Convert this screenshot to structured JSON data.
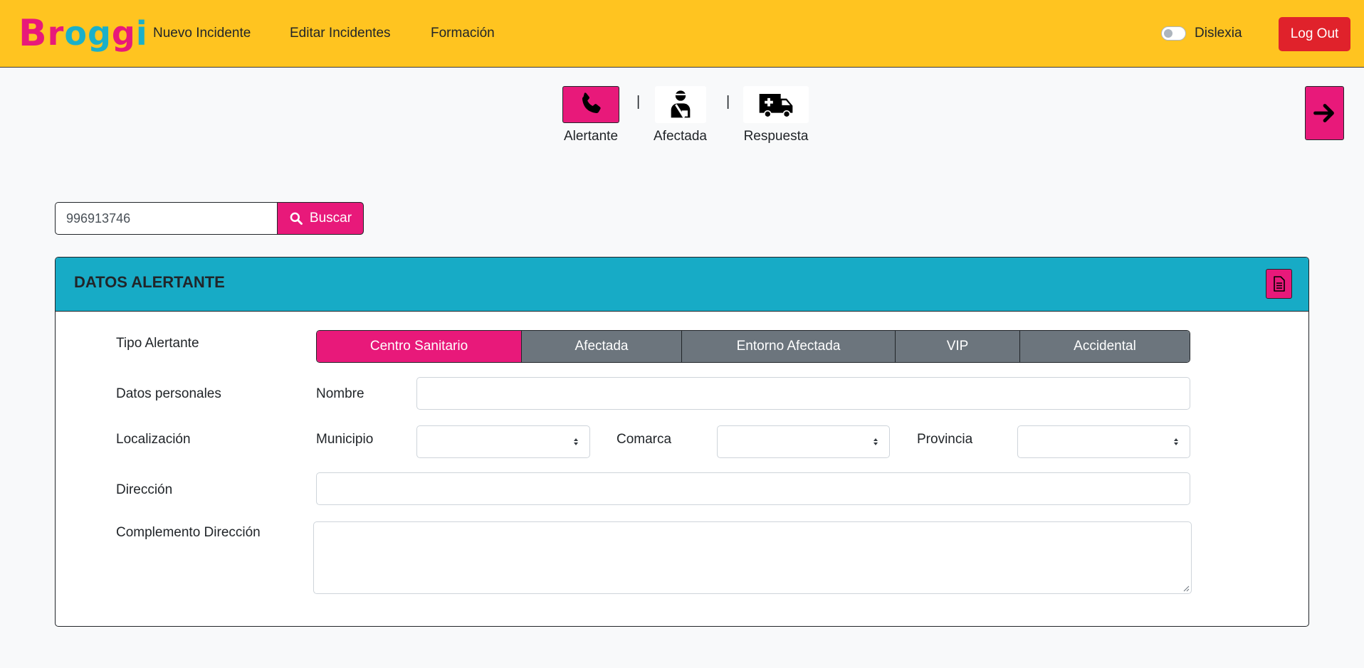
{
  "brand": {
    "logo_text": "Broggi"
  },
  "nav": {
    "items": [
      "Nuevo Incidente",
      "Editar Incidentes",
      "Formación"
    ],
    "dyslexia_label": "Dislexia",
    "logout_label": "Log Out"
  },
  "steps": [
    {
      "label": "Alertante",
      "icon": "phone-icon",
      "active": true
    },
    {
      "label": "Afectada",
      "icon": "injured-person-icon",
      "active": false
    },
    {
      "label": "Respuesta",
      "icon": "ambulance-icon",
      "active": false
    }
  ],
  "search": {
    "value": "996913746",
    "button_label": "Buscar"
  },
  "card": {
    "title": "DATOS ALERTANTE",
    "tipo_label": "Tipo Alertante",
    "tipo_options": [
      "Centro Sanitario",
      "Afectada",
      "Entorno Afectada",
      "VIP",
      "Accidental"
    ],
    "tipo_selected": "Centro Sanitario",
    "datos_label": "Datos personales",
    "nombre_label": "Nombre",
    "localizacion_label": "Localización",
    "municipio_label": "Municipio",
    "comarca_label": "Comarca",
    "provincia_label": "Provincia",
    "direccion_label": "Dirección",
    "complemento_label": "Complemento Dirección"
  },
  "colors": {
    "navbar": "#ffc420",
    "accent": "#e8197a",
    "header": "#17abc6",
    "segment": "#6c757d",
    "logout": "#e0222b"
  }
}
